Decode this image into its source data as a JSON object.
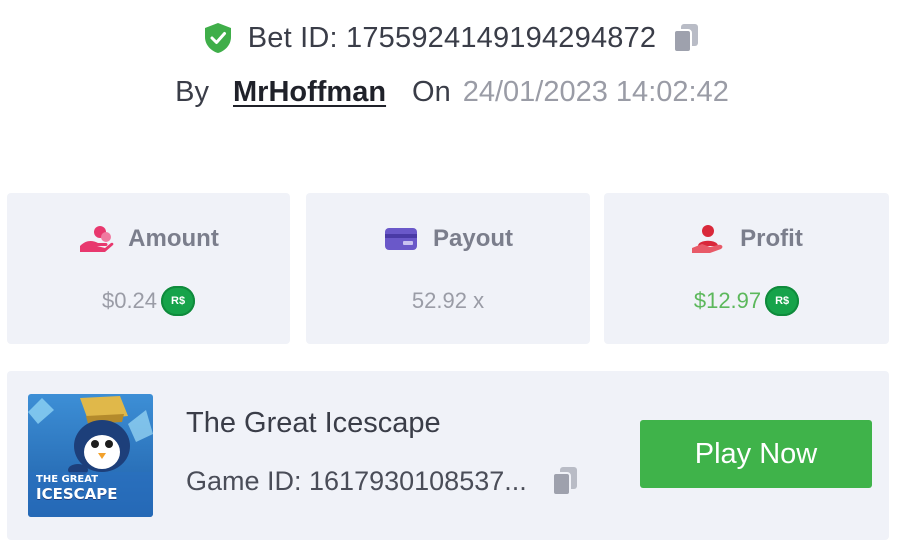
{
  "bet": {
    "id_text": "Bet ID: 17559241491942948​72",
    "by_label": "By",
    "username": "MrHoffman",
    "on_label": "On",
    "datetime": "24/01/2023 14:02:42"
  },
  "stats": {
    "amount": {
      "label": "Amount",
      "value": "$0.24",
      "currency_badge": "R$"
    },
    "payout": {
      "label": "Payout",
      "value": "52.92 x"
    },
    "profit": {
      "label": "Profit",
      "value": "$12.97",
      "currency_badge": "R$"
    }
  },
  "game": {
    "title": "The Great Icescape",
    "id_text": "Game ID: 1617930108537...",
    "play_label": "Play Now",
    "thumb_line1": "THE GREAT",
    "thumb_line2": "ICESCAPE"
  },
  "icons": {
    "verified": "shield-check-icon",
    "copy": "copy-icon",
    "amount": "coins-hand-icon",
    "payout": "wallet-card-icon",
    "profit": "user-money-icon"
  },
  "colors": {
    "verified_green": "#3fae49",
    "profit_green": "#5cb85c",
    "play_button": "#3fb34a",
    "badge_green": "#16a34a",
    "amount_icon": "#e8386e",
    "payout_icon": "#6a58c9",
    "profit_icon": "#d9283a",
    "card_bg": "#f0f2f8"
  }
}
